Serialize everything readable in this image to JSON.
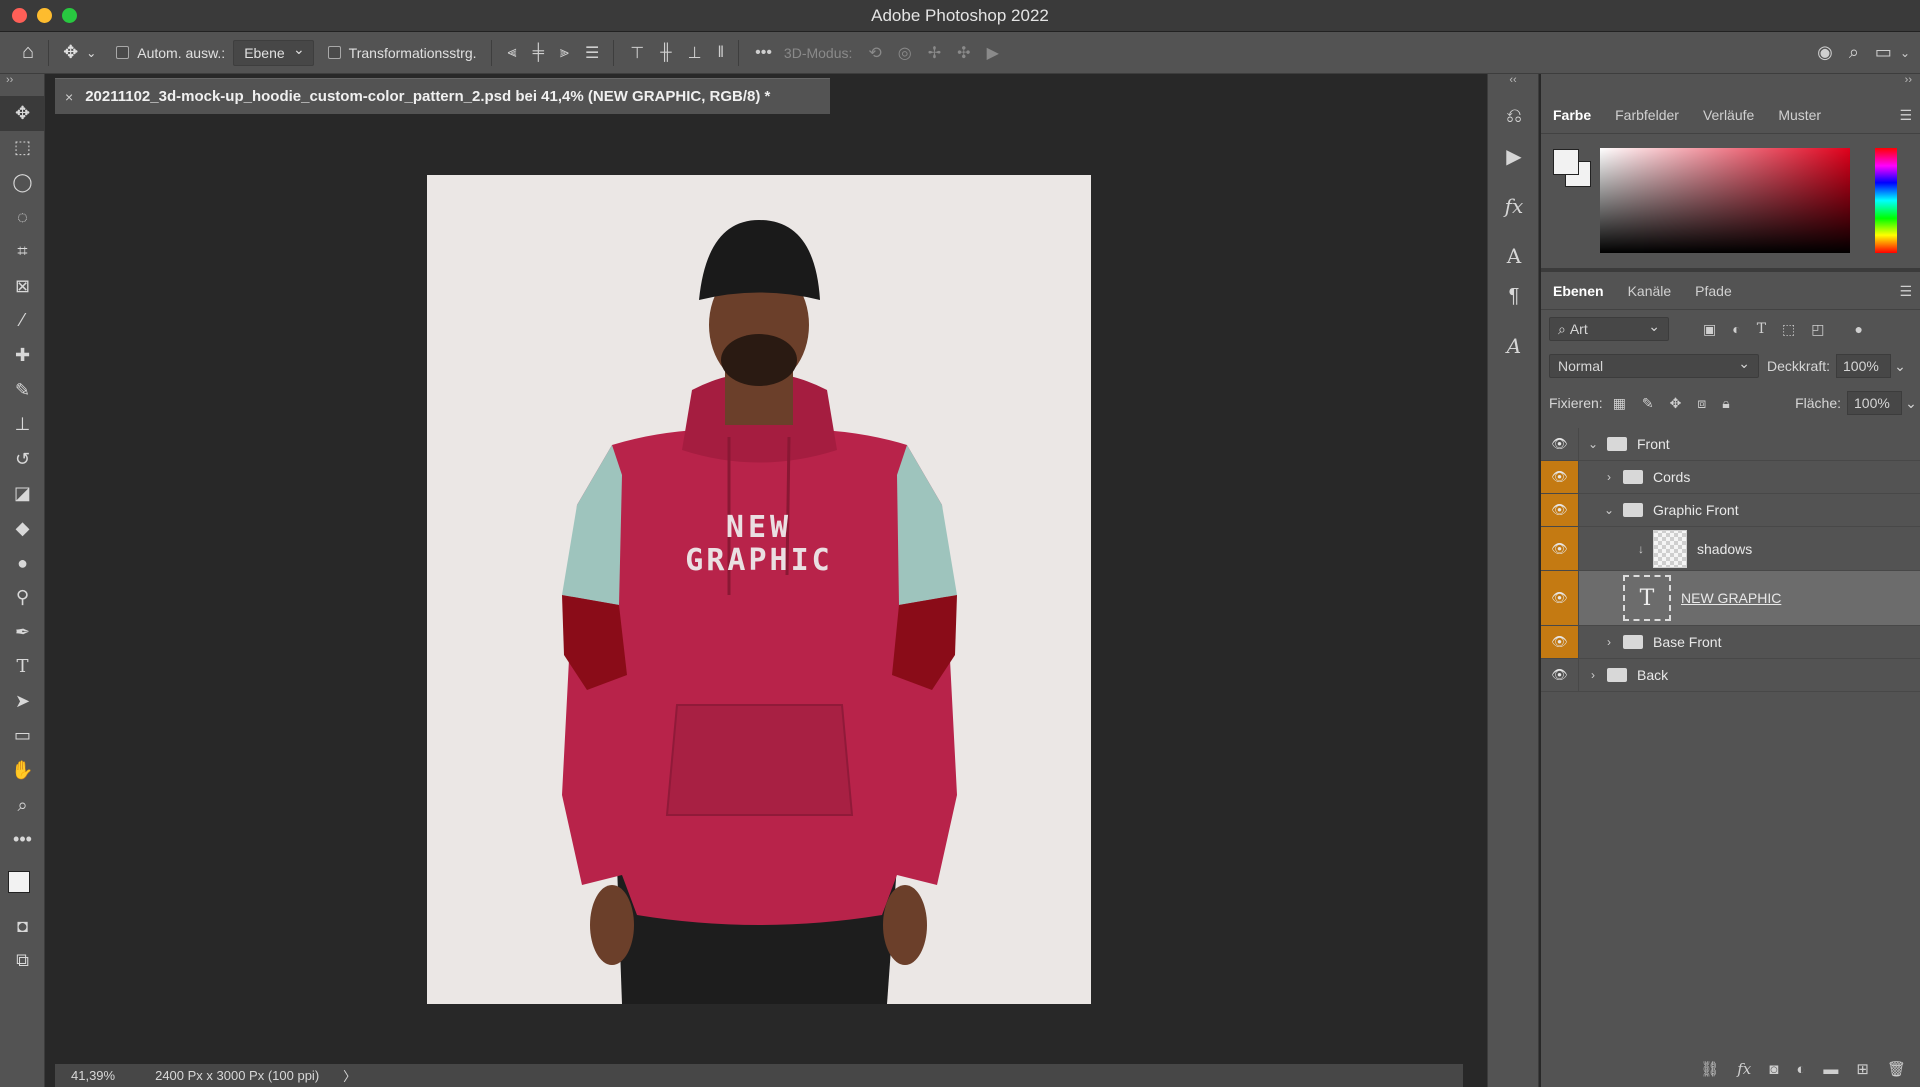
{
  "app": {
    "title": "Adobe Photoshop 2022"
  },
  "options_bar": {
    "auto_select_label": "Autom. ausw.:",
    "auto_select_target": "Ebene",
    "transform_label": "Transformationsstrg.",
    "more": "•••",
    "mode_label": "3D-Modus:"
  },
  "document": {
    "tab_title": "20211102_3d-mock-up_hoodie_custom-color_pattern_2.psd bei 41,4% (NEW GRAPHIC, RGB/8) *",
    "close": "×",
    "hoodie_text_1": "NEW",
    "hoodie_text_2": "GRAPHIC",
    "hoodie_color": "#b8234a",
    "sleeve_color": "#9ec4bd",
    "accent_color": "#8a0c18"
  },
  "status": {
    "zoom": "41,39%",
    "size": "2400 Px x 3000 Px (100 ppi)",
    "arrow": "〉"
  },
  "color_panel": {
    "tabs": [
      "Farbe",
      "Farbfelder",
      "Verläufe",
      "Muster"
    ],
    "fg": "#f2f2f2",
    "bg": "#f2f2f2"
  },
  "layers_panel": {
    "tabs": [
      "Ebenen",
      "Kanäle",
      "Pfade"
    ],
    "filter": "Art",
    "blend_mode": "Normal",
    "opacity_label": "Deckkraft:",
    "opacity": "100%",
    "lock_label": "Fixieren:",
    "fill_label": "Fläche:",
    "fill": "100%",
    "layers": [
      {
        "name": "Front"
      },
      {
        "name": "Cords"
      },
      {
        "name": "Graphic Front"
      },
      {
        "name": "shadows"
      },
      {
        "name": "NEW GRAPHIC"
      },
      {
        "name": "Base Front"
      },
      {
        "name": "Back"
      }
    ]
  },
  "highlight_color": "#c47a12"
}
